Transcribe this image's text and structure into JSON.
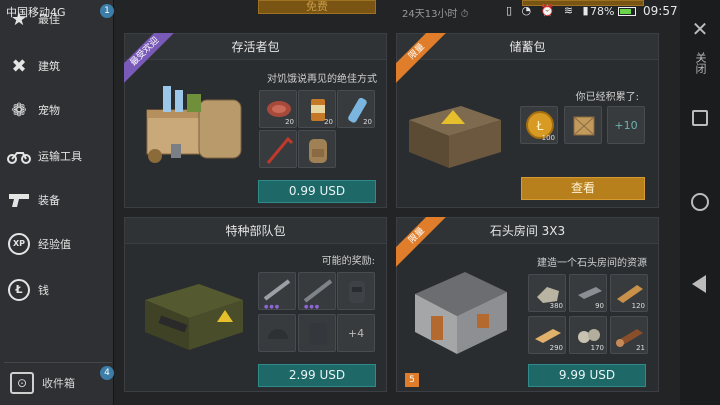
{
  "status": {
    "carrier": "中国移动4G",
    "badge": "1",
    "timer": "24天13小时 ⏱",
    "battery": "78%",
    "battery_level": 0.78,
    "time": "09:57"
  },
  "sidebar": {
    "items": [
      {
        "label": "最佳",
        "icon": "star-icon"
      },
      {
        "label": "建筑",
        "icon": "tools-icon"
      },
      {
        "label": "宠物",
        "icon": "paw-icon"
      },
      {
        "label": "运输工具",
        "icon": "motorcycle-icon"
      },
      {
        "label": "装备",
        "icon": "pistol-icon"
      },
      {
        "label": "经验值",
        "icon": "xp-icon"
      },
      {
        "label": "钱",
        "icon": "coin-icon"
      }
    ],
    "inbox": {
      "label": "收件箱",
      "badge": "4"
    }
  },
  "peek": {
    "left_label": "免费"
  },
  "cards": {
    "survivor": {
      "title": "存活者包",
      "ribbon": "最受欢迎",
      "desc": "对饥饿说再见的绝佳方式",
      "items": [
        {
          "icon": "steak-icon",
          "count": "20"
        },
        {
          "icon": "can-icon",
          "count": "20"
        },
        {
          "icon": "water-bottle-icon",
          "count": "20"
        },
        {
          "icon": "crowbar-icon",
          "count": ""
        },
        {
          "icon": "backpack-icon",
          "count": ""
        }
      ],
      "price": "0.99 USD"
    },
    "savings": {
      "title": "储蓄包",
      "ribbon": "限量",
      "desc": "你已经积累了:",
      "items": [
        {
          "icon": "coin-icon",
          "count": "100"
        },
        {
          "icon": "crate-icon",
          "count": ""
        }
      ],
      "plus": "+10",
      "button": "查看"
    },
    "special": {
      "title": "特种部队包",
      "desc": "可能的奖励:",
      "items": [
        {
          "icon": "rifle-icon",
          "count": ""
        },
        {
          "icon": "sniper-icon",
          "count": ""
        },
        {
          "icon": "armor-icon",
          "count": ""
        },
        {
          "icon": "helmet-icon",
          "count": ""
        },
        {
          "icon": "vest-icon",
          "count": ""
        }
      ],
      "plus": "+4",
      "price": "2.99 USD"
    },
    "stone": {
      "title": "石头房间 3X3",
      "ribbon": "限量",
      "desc": "建造一个石头房间的资源",
      "level": "5",
      "items": [
        {
          "icon": "stone-icon",
          "count": "380"
        },
        {
          "icon": "iron-bar-icon",
          "count": "90"
        },
        {
          "icon": "wood-plank-icon",
          "count": "120"
        },
        {
          "icon": "lumber-icon",
          "count": "290"
        },
        {
          "icon": "rock-pile-icon",
          "count": "170"
        },
        {
          "icon": "log-icon",
          "count": "21"
        }
      ],
      "price": "9.99 USD"
    }
  },
  "nav": {
    "close_label": "关闭"
  }
}
